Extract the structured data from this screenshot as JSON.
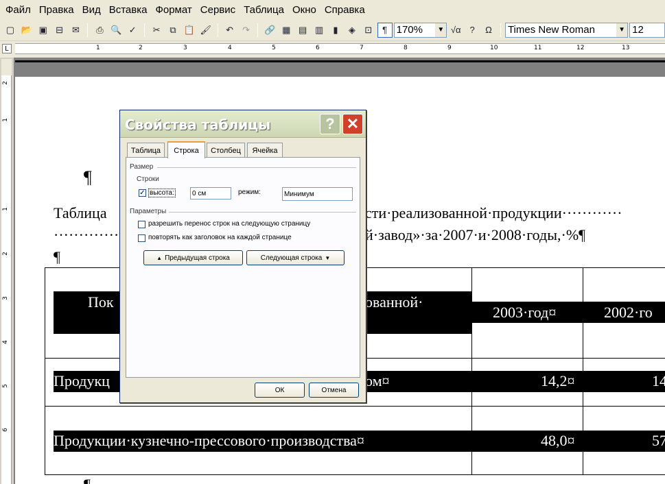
{
  "menu": [
    "Файл",
    "Правка",
    "Вид",
    "Вставка",
    "Формат",
    "Сервис",
    "Таблица",
    "Окно",
    "Справка"
  ],
  "toolbar": {
    "zoom": "170%",
    "font_name": "Times New Roman",
    "font_size": "12",
    "icons": [
      "new-icon",
      "open-icon",
      "save-icon",
      "permission-icon",
      "email-icon",
      "print-icon",
      "preview-icon",
      "spelling-icon",
      "cut-icon",
      "copy-icon",
      "paste-icon",
      "format-painter-icon",
      "undo-icon",
      "redo-icon",
      "hyperlink-icon",
      "tables-borders-icon",
      "insert-table-icon",
      "insert-excel-icon",
      "columns-icon",
      "drawing-icon",
      "document-map-icon",
      "show-formatting-icon"
    ]
  },
  "ruler": {
    "numbers": [
      "1",
      "2",
      "3",
      "4",
      "5",
      "6",
      "7",
      "8",
      "9",
      "10",
      "11",
      "12",
      "13"
    ]
  },
  "vruler": {
    "numbers": [
      "2",
      "1",
      "1",
      "2",
      "3",
      "4",
      "5",
      "6"
    ]
  },
  "document": {
    "pilcrow_top": "¶",
    "caption_line1": "Таблица",
    "caption_line1_tail": "сти·реализованной·продукции············",
    "caption_line2_dots": "··············",
    "caption_line2_tail": "й·завод»·за·2007·и·2008·годы,·%¶",
    "pilcrow_mid": "¶",
    "pilcrow_bottom": "¶",
    "table": {
      "header_left": "Пок",
      "header_left_tail": "ованной·",
      "header_c2": "2003·год¤",
      "header_c3": "2002·го",
      "row1_label": "Продукц",
      "row1_label_tail": "ом¤",
      "row1_c2": "14,2¤",
      "row1_c3": "14",
      "row2_label": "Продукции·кузнечно-прессового·производства¤",
      "row2_c2": "48,0¤",
      "row2_c3": "57"
    }
  },
  "dialog": {
    "title": "Свойства таблицы",
    "tabs": [
      "Таблица",
      "Строка",
      "Столбец",
      "Ячейка"
    ],
    "active_tab": "Строка",
    "size_group": "Размер",
    "rows_group": "Строки",
    "height_label": "высота:",
    "height_value": "0 см",
    "mode_label": "режим:",
    "mode_value": "Минимум",
    "params_group": "Параметры",
    "allow_break": "разрешить перенос строк на следующую страницу",
    "repeat_header": "повторять как заголовок на каждой странице",
    "prev_row": "Предыдущая строка",
    "next_row": "Следующая строка",
    "ok": "ОК",
    "cancel": "Отмена"
  }
}
